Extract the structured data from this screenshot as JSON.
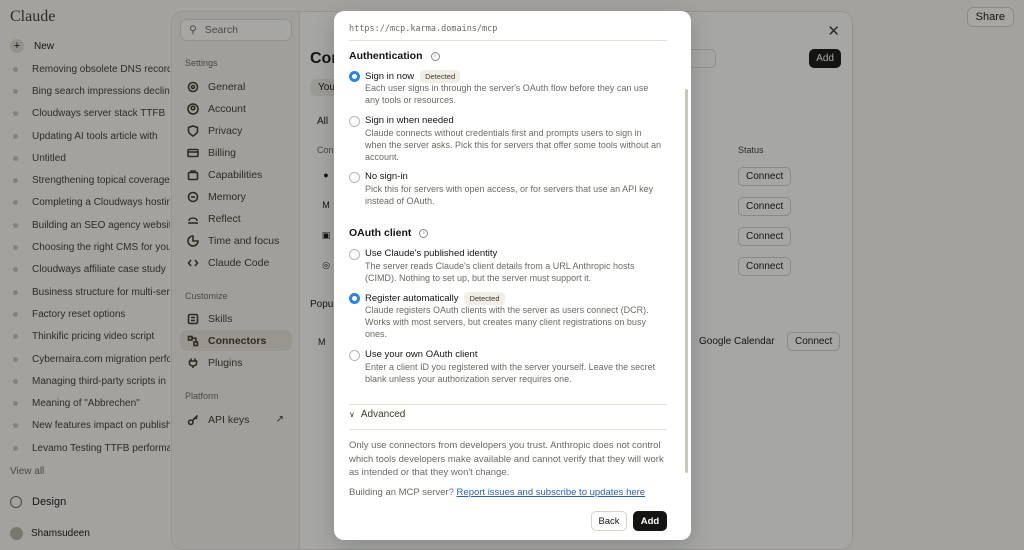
{
  "app": {
    "brand": "Claude",
    "share_label": "Share",
    "new_chat_label": "New",
    "chats": [
      "Removing obsolete DNS records",
      "Bing search impressions decline",
      "Cloudways server stack TTFB",
      "Updating AI tools article with",
      "Untitled",
      "Strengthening topical coverage",
      "Completing a Cloudways hosting",
      "Building an SEO agency website",
      "Choosing the right CMS for your",
      "Cloudways affiliate case study",
      "Business structure for multi-ser",
      "Factory reset options",
      "Thinkific pricing video script",
      "Cybernaira.com migration perfo",
      "Managing third-party scripts in",
      "Meaning of \"Abbrechen\"",
      "New features impact on publishe",
      "Levamo Testing TTFB performan"
    ],
    "view_all_label": "View all",
    "design_label": "Design",
    "user_name": "Shamsudeen"
  },
  "settings": {
    "search_placeholder": "Search",
    "section_settings": "Settings",
    "section_customize": "Customize",
    "section_platform": "Platform",
    "items_settings": [
      "General",
      "Account",
      "Privacy",
      "Billing",
      "Capabilities",
      "Memory",
      "Reflect",
      "Time and focus",
      "Claude Code"
    ],
    "items_customize": [
      "Skills",
      "Connectors",
      "Plugins"
    ],
    "items_platform": [
      "API keys"
    ],
    "title_partial": "Con",
    "add_label": "Add",
    "tab_partial": "You",
    "filter_all": "All",
    "col_connector_partial": "Con",
    "col_status": "Status",
    "connect_label": "Connect",
    "popular_partial": "Popul",
    "google_calendar": "Google Calendar"
  },
  "modal": {
    "url": "https://mcp.karma.domains/mcp",
    "auth_heading": "Authentication",
    "auth_options": [
      {
        "label": "Sign in now",
        "badge": "Detected",
        "selected": true,
        "desc": "Each user signs in through the server's OAuth flow before they can use any tools or resources."
      },
      {
        "label": "Sign in when needed",
        "badge": "",
        "selected": false,
        "desc": "Claude connects without credentials first and prompts users to sign in when the server asks. Pick this for servers that offer some tools without an account."
      },
      {
        "label": "No sign-in",
        "badge": "",
        "selected": false,
        "desc": "Pick this for servers with open access, or for servers that use an API key instead of OAuth."
      }
    ],
    "oauth_heading": "OAuth client",
    "oauth_options": [
      {
        "label": "Use Claude's published identity",
        "badge": "",
        "selected": false,
        "desc": "The server reads Claude's client details from a URL Anthropic hosts (CIMD). Nothing to set up, but the server must support it."
      },
      {
        "label": "Register automatically",
        "badge": "Detected",
        "selected": true,
        "desc": "Claude registers OAuth clients with the server as users connect (DCR). Works with most servers, but creates many client registrations on busy ones."
      },
      {
        "label": "Use your own OAuth client",
        "badge": "",
        "selected": false,
        "desc": "Enter a client ID you registered with the server yourself. Leave the secret blank unless your authorization server requires one."
      }
    ],
    "advanced_label": "Advanced",
    "warning": "Only use connectors from developers you trust. Anthropic does not control which tools developers make available and cannot verify that they will work as intended or that they won't change.",
    "mcp_prefix": "Building an MCP server?",
    "mcp_link": "Report issues and subscribe to updates here",
    "back_label": "Back",
    "add_label": "Add"
  }
}
